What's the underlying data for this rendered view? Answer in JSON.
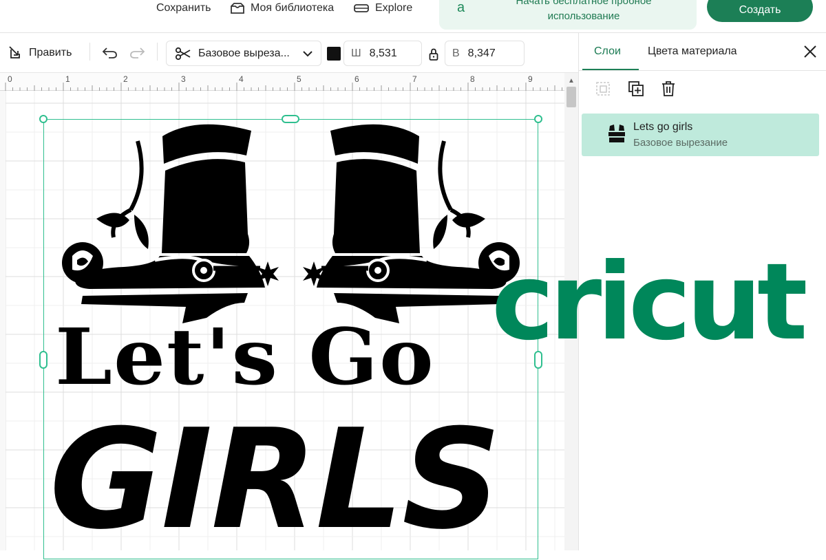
{
  "header": {
    "save_label": "Сохранить",
    "library_label": "Моя библиотека",
    "explore_label": "Explore",
    "trial_text": "Начать бесплатное пробное использование",
    "create_label": "Создать"
  },
  "toolbar": {
    "edit_label": "Править",
    "operation_label": "Базовое выреза...",
    "width_key": "Ш",
    "width_value": "8,531",
    "height_key": "В",
    "height_value": "8,347"
  },
  "ruler": {
    "marks": [
      "0",
      "1",
      "2",
      "3",
      "4",
      "5",
      "6",
      "7",
      "8",
      "9"
    ]
  },
  "canvas": {
    "text_line_1": "Let's Go",
    "text_line_2": "GIRLS"
  },
  "panel": {
    "tab_layers": "Слои",
    "tab_colors": "Цвета материала",
    "layer": {
      "name": "Lets go girls",
      "operation": "Базовое вырезание"
    }
  },
  "brand": {
    "logo_text": "cricut",
    "accent_color": "#00875a",
    "selection_color": "#2fbf8f"
  }
}
